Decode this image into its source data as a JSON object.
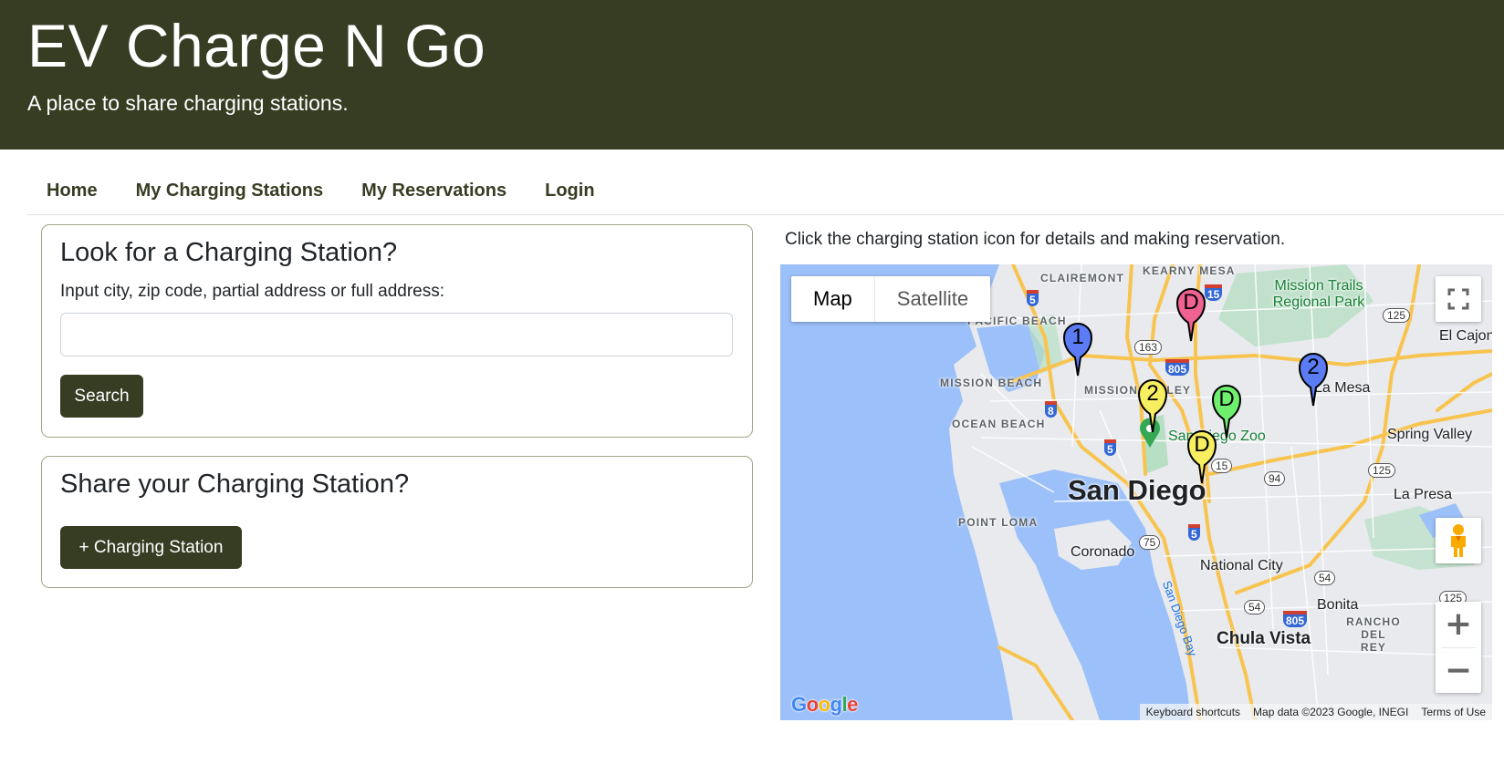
{
  "header": {
    "title": "EV Charge N Go",
    "subtitle": "A place to share charging stations."
  },
  "nav": {
    "items": [
      {
        "label": "Home"
      },
      {
        "label": "My Charging Stations"
      },
      {
        "label": "My Reservations"
      },
      {
        "label": "Login"
      }
    ]
  },
  "search_card": {
    "heading": "Look for a Charging Station?",
    "label": "Input city, zip code, partial address or full address:",
    "input_value": "",
    "input_placeholder": "",
    "button_label": "Search"
  },
  "share_card": {
    "heading": "Share your Charging Station?",
    "button_label": "+ Charging Station"
  },
  "map": {
    "caption": "Click the charging station icon for details and making reservation.",
    "map_type": {
      "active": "Map",
      "inactive": "Satellite"
    },
    "controls": {
      "fullscreen_icon": "fullscreen-icon",
      "pegman_icon": "street-view-pegman-icon",
      "zoom_in": "+",
      "zoom_out": "−"
    },
    "logo": "Google",
    "attribution": {
      "shortcuts": "Keyboard shortcuts",
      "data": "Map data ©2023 Google, INEGI",
      "terms": "Terms of Use"
    },
    "markers": [
      {
        "label": "1",
        "color": "#5b7cf5"
      },
      {
        "label": "D",
        "color": "#f06292"
      },
      {
        "label": "2",
        "color": "#f7ef60"
      },
      {
        "label": "D",
        "color": "#6ef06e"
      },
      {
        "label": "D",
        "color": "#f7ef60"
      },
      {
        "label": "2",
        "color": "#5b7cf5"
      }
    ],
    "place_labels": {
      "clairemont": "CLAIREMONT",
      "kearny_mesa": "KEARNY MESA",
      "pacific_beach": "PACIFIC BEACH",
      "mission_beach": "MISSION BEACH",
      "mission_valley": "MISSION VALLEY",
      "ocean_beach": "OCEAN BEACH",
      "point_loma": "POINT LOMA",
      "san_diego": "San Diego",
      "san_diego_zoo": "San Diego Zoo",
      "coronado": "Coronado",
      "national_city": "National City",
      "chula_vista": "Chula Vista",
      "bonita": "Bonita",
      "rancho_del_rey": "RANCHO DEL REY",
      "la_mesa": "La Mesa",
      "spring_valley": "Spring Valley",
      "la_presa": "La Presa",
      "el_cajon": "El Cajon",
      "mission_trails": "Mission Trails Regional Park",
      "san_diego_bay": "San Diego Bay"
    },
    "shields": [
      "5",
      "15",
      "805",
      "8",
      "5",
      "5",
      "805"
    ],
    "routes": [
      "163",
      "125",
      "15",
      "94",
      "125",
      "75",
      "54",
      "54",
      "125"
    ]
  }
}
